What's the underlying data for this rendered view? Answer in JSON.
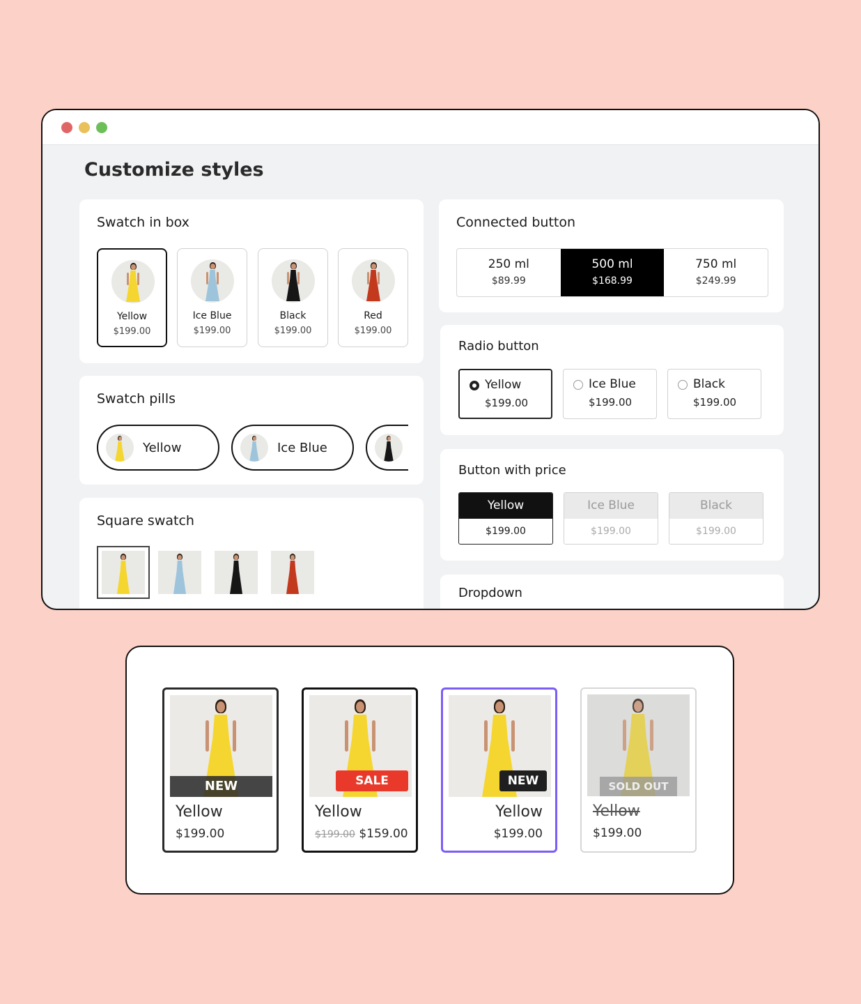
{
  "window": {
    "title": "Customize styles"
  },
  "swatch_in_box": {
    "title": "Swatch in box",
    "items": [
      {
        "name": "Yellow",
        "price": "$199.00",
        "color": "#f5d630",
        "icon": "yellow-dress-icon"
      },
      {
        "name": "Ice Blue",
        "price": "$199.00",
        "color": "#9ec4dc",
        "icon": "ice-blue-dress-icon"
      },
      {
        "name": "Black",
        "price": "$199.00",
        "color": "#161616",
        "icon": "black-dress-icon"
      },
      {
        "name": "Red",
        "price": "$199.00",
        "color": "#c2391e",
        "icon": "red-dress-icon"
      }
    ]
  },
  "swatch_pills": {
    "title": "Swatch pills",
    "items": [
      {
        "name": "Yellow",
        "color": "#f5d630"
      },
      {
        "name": "Ice Blue",
        "color": "#9ec4dc"
      },
      {
        "name": "",
        "color": "#161616"
      }
    ]
  },
  "square_swatch": {
    "title": "Square swatch",
    "colors": [
      "#f5d630",
      "#9ec4dc",
      "#161616",
      "#c2391e"
    ]
  },
  "connected_button": {
    "title": "Connected button",
    "items": [
      {
        "label": "250 ml",
        "price": "$89.99"
      },
      {
        "label": "500 ml",
        "price": "$168.99"
      },
      {
        "label": "750 ml",
        "price": "$249.99"
      }
    ]
  },
  "radio_button": {
    "title": "Radio button",
    "items": [
      {
        "name": "Yellow",
        "price": "$199.00"
      },
      {
        "name": "Ice Blue",
        "price": "$199.00"
      },
      {
        "name": "Black",
        "price": "$199.00"
      }
    ]
  },
  "button_with_price": {
    "title": "Button with price",
    "items": [
      {
        "name": "Yellow",
        "price": "$199.00"
      },
      {
        "name": "Ice Blue",
        "price": "$199.00"
      },
      {
        "name": "Black",
        "price": "$199.00"
      }
    ]
  },
  "dropdown": {
    "title": "Dropdown"
  },
  "product_cards": [
    {
      "badge": "NEW",
      "title": "Yellow",
      "price": "$199.00"
    },
    {
      "badge": "SALE",
      "title": "Yellow",
      "old_price": "$199.00",
      "price": "$159.00"
    },
    {
      "badge": "NEW",
      "title": "Yellow",
      "price": "$199.00"
    },
    {
      "badge": "SOLD OUT",
      "title": "Yellow",
      "price": "$199.00"
    }
  ],
  "colors": {
    "background": "#fcd1c7",
    "selected_accent": "#7b5cf5",
    "sale_red": "#e8392a"
  }
}
